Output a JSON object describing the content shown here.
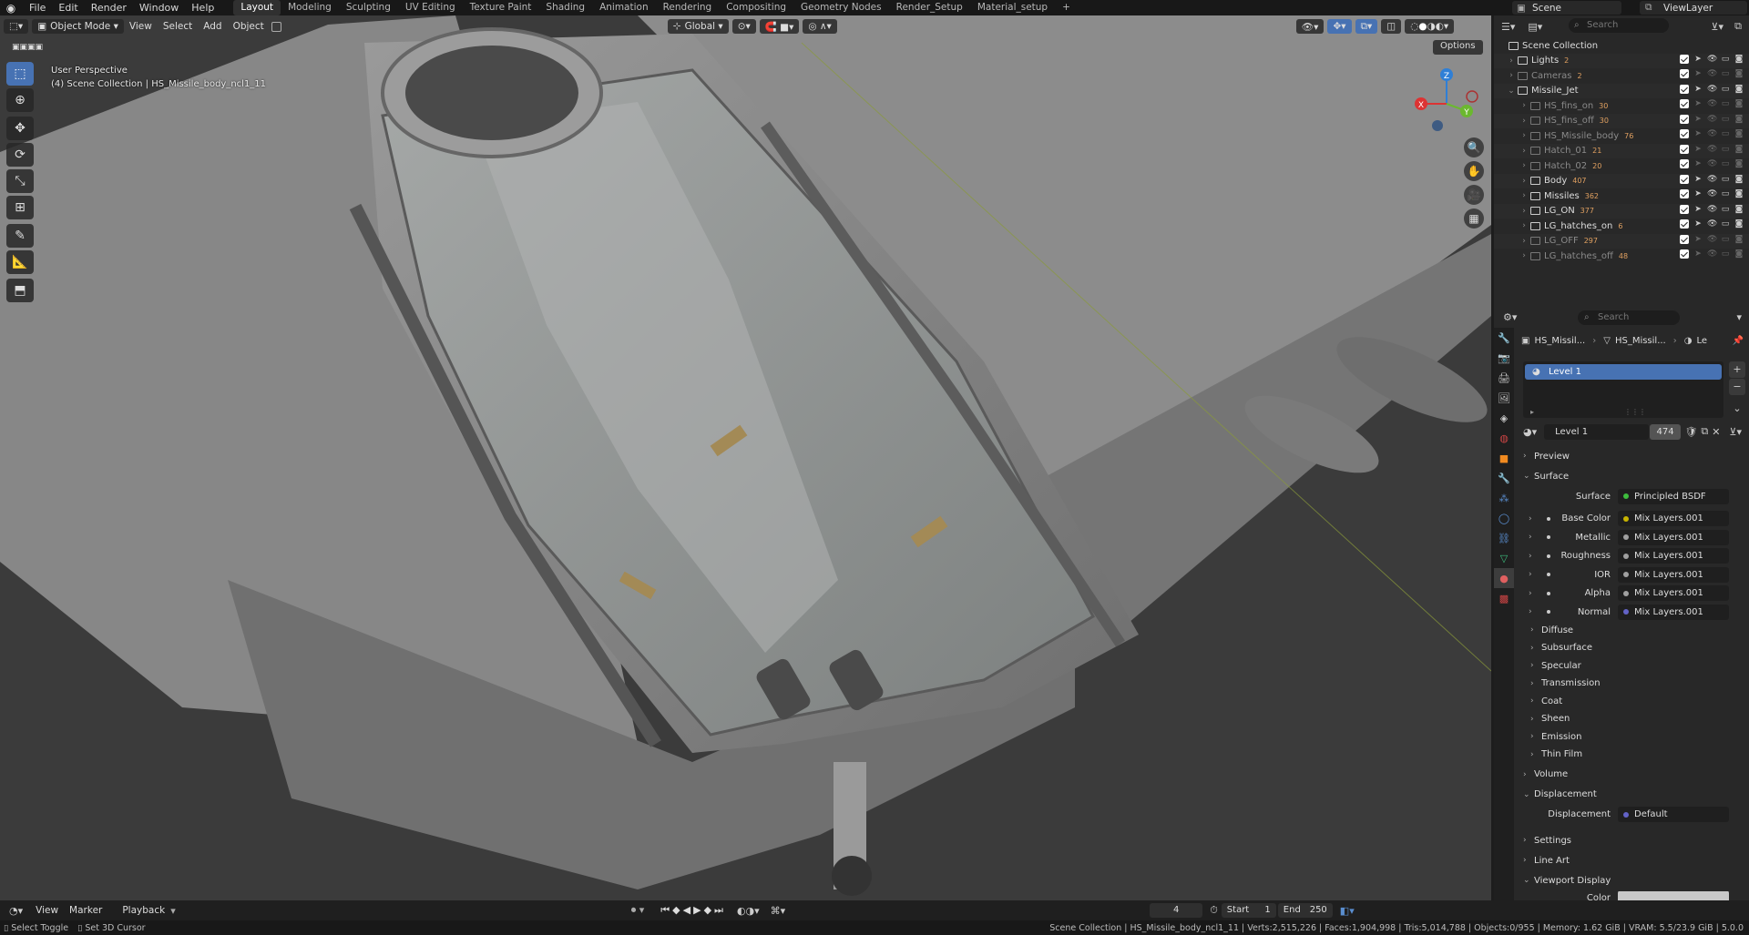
{
  "topbar": {
    "menus": [
      "File",
      "Edit",
      "Render",
      "Window",
      "Help"
    ],
    "workspaces": [
      "Layout",
      "Modeling",
      "Sculpting",
      "UV Editing",
      "Texture Paint",
      "Shading",
      "Animation",
      "Rendering",
      "Compositing",
      "Geometry Nodes",
      "Render_Setup",
      "Material_setup"
    ],
    "active_workspace": "Layout",
    "add_tab": "+",
    "scene": "Scene",
    "view_layer": "ViewLayer"
  },
  "viewport": {
    "mode": "Object Mode",
    "menus": [
      "View",
      "Select",
      "Add",
      "Object"
    ],
    "orientation": "Global",
    "options": "Options",
    "perspective": "User Perspective",
    "collection_info": "(4) Scene Collection | HS_Missile_body_ncl1_11",
    "gizmo": {
      "z": "Z",
      "x": "X",
      "y": "Y"
    }
  },
  "outliner": {
    "search_placeholder": "Search",
    "root": "Scene Collection",
    "items": [
      {
        "label": "Lights",
        "badge": "2",
        "dim": false,
        "indent": 1
      },
      {
        "label": "Cameras",
        "badge": "2",
        "dim": true,
        "indent": 1
      },
      {
        "label": "Missile_Jet",
        "badge": "",
        "dim": false,
        "indent": 1
      },
      {
        "label": "HS_fins_on",
        "badge": "30",
        "dim": true,
        "indent": 2
      },
      {
        "label": "HS_fins_off",
        "badge": "30",
        "dim": true,
        "indent": 2
      },
      {
        "label": "HS_Missile_body",
        "badge": "76",
        "dim": true,
        "indent": 2
      },
      {
        "label": "Hatch_01",
        "badge": "21",
        "dim": true,
        "indent": 2
      },
      {
        "label": "Hatch_02",
        "badge": "20",
        "dim": true,
        "indent": 2
      },
      {
        "label": "Body",
        "badge": "407",
        "dim": false,
        "indent": 2
      },
      {
        "label": "Missiles",
        "badge": "362",
        "dim": false,
        "indent": 2
      },
      {
        "label": "LG_ON",
        "badge": "377",
        "dim": false,
        "indent": 2
      },
      {
        "label": "LG_hatches_on",
        "badge": "6",
        "dim": false,
        "indent": 2
      },
      {
        "label": "LG_OFF",
        "badge": "297",
        "dim": true,
        "indent": 2
      },
      {
        "label": "LG_hatches_off",
        "badge": "48",
        "dim": true,
        "indent": 2
      }
    ]
  },
  "properties": {
    "search_placeholder": "Search",
    "breadcrumb": [
      "HS_Missil...",
      "HS_Missil...",
      "Le"
    ],
    "slot": "Level 1",
    "material_name": "Level 1",
    "material_users": "474",
    "panels": {
      "preview": "Preview",
      "surface": "Surface",
      "surface_label": "Surface",
      "surface_value": "Principled BSDF",
      "inputs": [
        {
          "label": "Base Color",
          "value": "Mix Layers.001",
          "color": "#c8b400"
        },
        {
          "label": "Metallic",
          "value": "Mix Layers.001",
          "color": "#a0a0a0"
        },
        {
          "label": "Roughness",
          "value": "Mix Layers.001",
          "color": "#a0a0a0"
        },
        {
          "label": "IOR",
          "value": "Mix Layers.001",
          "color": "#a0a0a0"
        },
        {
          "label": "Alpha",
          "value": "Mix Layers.001",
          "color": "#a0a0a0"
        },
        {
          "label": "Normal",
          "value": "Mix Layers.001",
          "color": "#6363c7"
        }
      ],
      "subpanels": [
        "Diffuse",
        "Subsurface",
        "Specular",
        "Transmission",
        "Coat",
        "Sheen",
        "Emission",
        "Thin Film"
      ],
      "volume": "Volume",
      "displacement": "Displacement",
      "displacement_label": "Displacement",
      "displacement_value": "Default",
      "settings": "Settings",
      "line_art": "Line Art",
      "viewport_display": "Viewport Display",
      "color_label": "Color"
    }
  },
  "timeline": {
    "menus": [
      "View",
      "Marker",
      "Playback"
    ],
    "current_frame": "4",
    "start_label": "Start",
    "start": "1",
    "end_label": "End",
    "end": "250"
  },
  "statusbar": {
    "left1": "Select Toggle",
    "left2": "Set 3D Cursor",
    "info": "Scene Collection | HS_Missile_body_ncl1_11 | Verts:2,515,226 | Faces:1,904,998 | Tris:5,014,788 | Objects:0/955 | Memory: 1.62 GiB | VRAM: 5.5/23.9 GiB | 5.0.0"
  }
}
